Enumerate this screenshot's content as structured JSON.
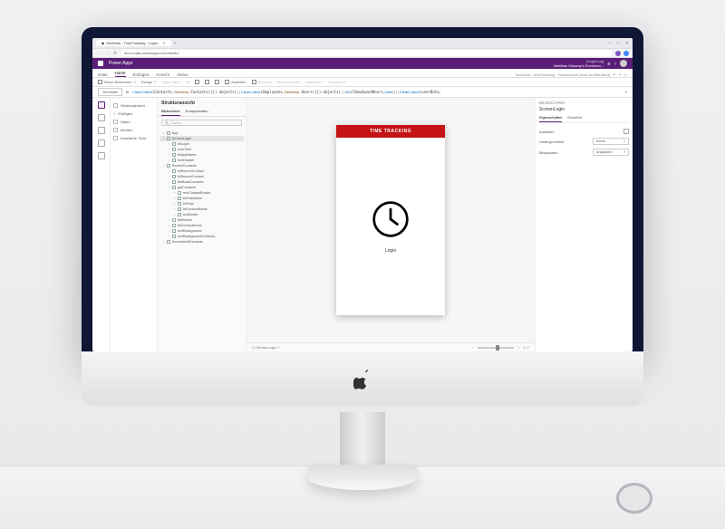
{
  "browser": {
    "tab_title": "SevDesk - TimeTracking - Login...",
    "url": "dev.create.powerapps.com/studio/",
    "win_min": "—",
    "win_max": "□",
    "win_close": "✕"
  },
  "pa_header": {
    "product": "Power Apps",
    "env_label": "Umgebung",
    "env_name": "Matthias Oskamp's Environm..."
  },
  "ribbon": {
    "tabs": [
      "Datei",
      "Home",
      "Einfügen",
      "Ansicht",
      "Aktion"
    ],
    "active": 1,
    "crumb": "SevDesk - TimeTracking - Gespeichert (nicht veröffentlicht)",
    "tools": {
      "new_screen": "Neuer Bildschirm",
      "design": "Design",
      "font": "Open Sans",
      "size": "13",
      "fill": "Ausfüllen",
      "border": "Rahmen",
      "reorder": "Neu anordnen",
      "align": "Ausrichten",
      "group": "Gruppieren"
    }
  },
  "formula": {
    "property": "OnVisible",
    "fx": "fx",
    "code_plain": "ClearCollect(Contacts,SevDesk.Contacts({}).objects);;ClearCollect(Employees,SevDesk.Users({}).objects);;Set(ShowSavedHours,false);;ClearCollect(userData,..."
  },
  "left_rail": {
    "items": [
      "Strukturansicht",
      "Einfügen",
      "Daten",
      "Medien",
      "Erweiterte Tools"
    ]
  },
  "tree": {
    "title": "Strukturansicht",
    "tab1": "Bildschirme",
    "tab2": "Komponenten",
    "search_ph": "Suchen",
    "nodes": [
      {
        "l": 0,
        "t": "App"
      },
      {
        "l": 0,
        "t": "ScreenLogin",
        "sel": true
      },
      {
        "l": 1,
        "t": "lblLogin"
      },
      {
        "l": 1,
        "t": "IconTime"
      },
      {
        "l": 1,
        "t": "lblAppName"
      },
      {
        "l": 1,
        "t": "rectHeader"
      },
      {
        "l": 0,
        "t": "ScreenContacts"
      },
      {
        "l": 1,
        "t": "txtSearchContact"
      },
      {
        "l": 1,
        "t": "lblSearchContact"
      },
      {
        "l": 1,
        "t": "btnBackContacts"
      },
      {
        "l": 1,
        "t": "galContacts"
      },
      {
        "l": 2,
        "t": "rectContactBorder"
      },
      {
        "l": 2,
        "t": "lblTotalValue"
      },
      {
        "l": 2,
        "t": "lblTotal"
      },
      {
        "l": 2,
        "t": "lblContactName"
      },
      {
        "l": 2,
        "t": "icoDetails"
      },
      {
        "l": 1,
        "t": "lblHeader"
      },
      {
        "l": 1,
        "t": "lblContactHours"
      },
      {
        "l": 1,
        "t": "rectBackground"
      },
      {
        "l": 1,
        "t": "rectBackgroundContacts"
      },
      {
        "l": 0,
        "t": "ScreenAddContacts"
      }
    ]
  },
  "canvas": {
    "app_title": "TIME TRACKING",
    "login_text": "Login",
    "breadcrumb": "ScreenLogin",
    "zoom_out": "−",
    "zoom_in": "+",
    "fit": "↙↗"
  },
  "props": {
    "category": "BILDSCHIRM",
    "object": "ScreenLogin",
    "tab1": "Eigenschaften",
    "tab2": "Erweitert",
    "rows": {
      "fill_label": "Ausfüllen",
      "bgimage_label": "Hintergrundbild",
      "bgimage_val": "Keine",
      "bgpos_label": "Bildposition",
      "bgpos_val": "Anpassen"
    }
  }
}
